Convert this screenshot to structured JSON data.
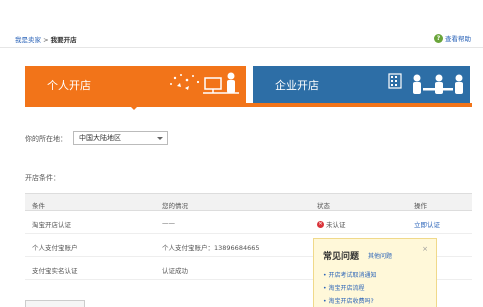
{
  "breadcrumb": {
    "parent": "我是卖家",
    "separator": " > ",
    "current": "我要开店"
  },
  "help": {
    "icon": "question-icon",
    "label": "查看帮助"
  },
  "banners": {
    "personal": {
      "label": "个人开店",
      "color": "#f27419"
    },
    "company": {
      "label": "企业开店",
      "color": "#2d6ea6"
    }
  },
  "region": {
    "label": "你的所在地：",
    "selected": "中国大陆地区"
  },
  "conditions": {
    "title": "开店条件：",
    "columns": [
      "条件",
      "您的情况",
      "状态",
      "操作"
    ],
    "rows": [
      {
        "condition": "淘宝开店认证",
        "situation": "——",
        "status": "未认证",
        "status_icon": "fail-icon",
        "action": "立即认证"
      },
      {
        "condition": "个人支付宝账户",
        "situation": "个人支付宝账户：13896684665",
        "status": "",
        "action": ""
      },
      {
        "condition": "支付宝实名认证",
        "situation": "认证成功",
        "status": "",
        "action": ""
      }
    ]
  },
  "faq": {
    "title": "常见问题",
    "other_link": "其他问题",
    "close": "×",
    "items": [
      "• 开店考试取消通知",
      "• 淘宝开店流程",
      "• 淘宝开店收费吗?"
    ]
  }
}
